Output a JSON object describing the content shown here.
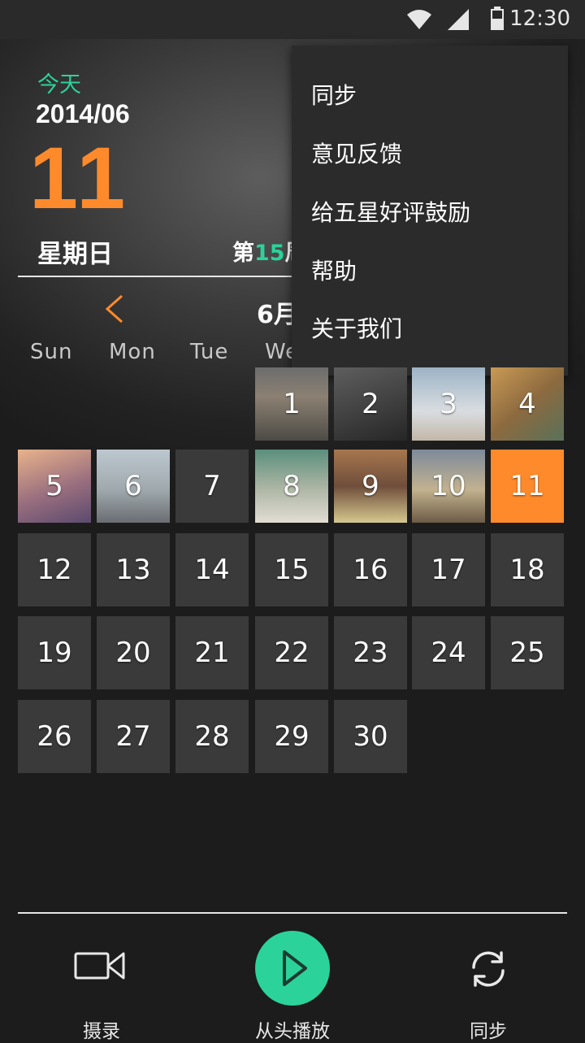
{
  "status_bar": {
    "time": "12:30"
  },
  "header": {
    "today_label": "今天",
    "year_month": "2014/06",
    "day": "11",
    "weekday": "星期日",
    "week_prefix": "第",
    "week_number": "15",
    "week_suffix": "周"
  },
  "calendar": {
    "month_label": "6月",
    "weekdays": [
      "Sun",
      "Mon",
      "Tue",
      "We"
    ],
    "days": [
      "1",
      "2",
      "3",
      "4",
      "5",
      "6",
      "7",
      "8",
      "9",
      "10",
      "11",
      "12",
      "13",
      "14",
      "15",
      "16",
      "17",
      "18",
      "19",
      "20",
      "21",
      "22",
      "23",
      "24",
      "25",
      "26",
      "27",
      "28",
      "29",
      "30"
    ],
    "today": "11"
  },
  "menu": {
    "items": [
      "同步",
      "意见反馈",
      "给五星好评鼓励",
      "帮助",
      "关于我们"
    ]
  },
  "bottom_bar": {
    "record_label": "摄录",
    "play_label": "从头播放",
    "sync_label": "同步"
  },
  "colors": {
    "accent_green": "#2bd39a",
    "accent_orange": "#ff8a2b"
  }
}
